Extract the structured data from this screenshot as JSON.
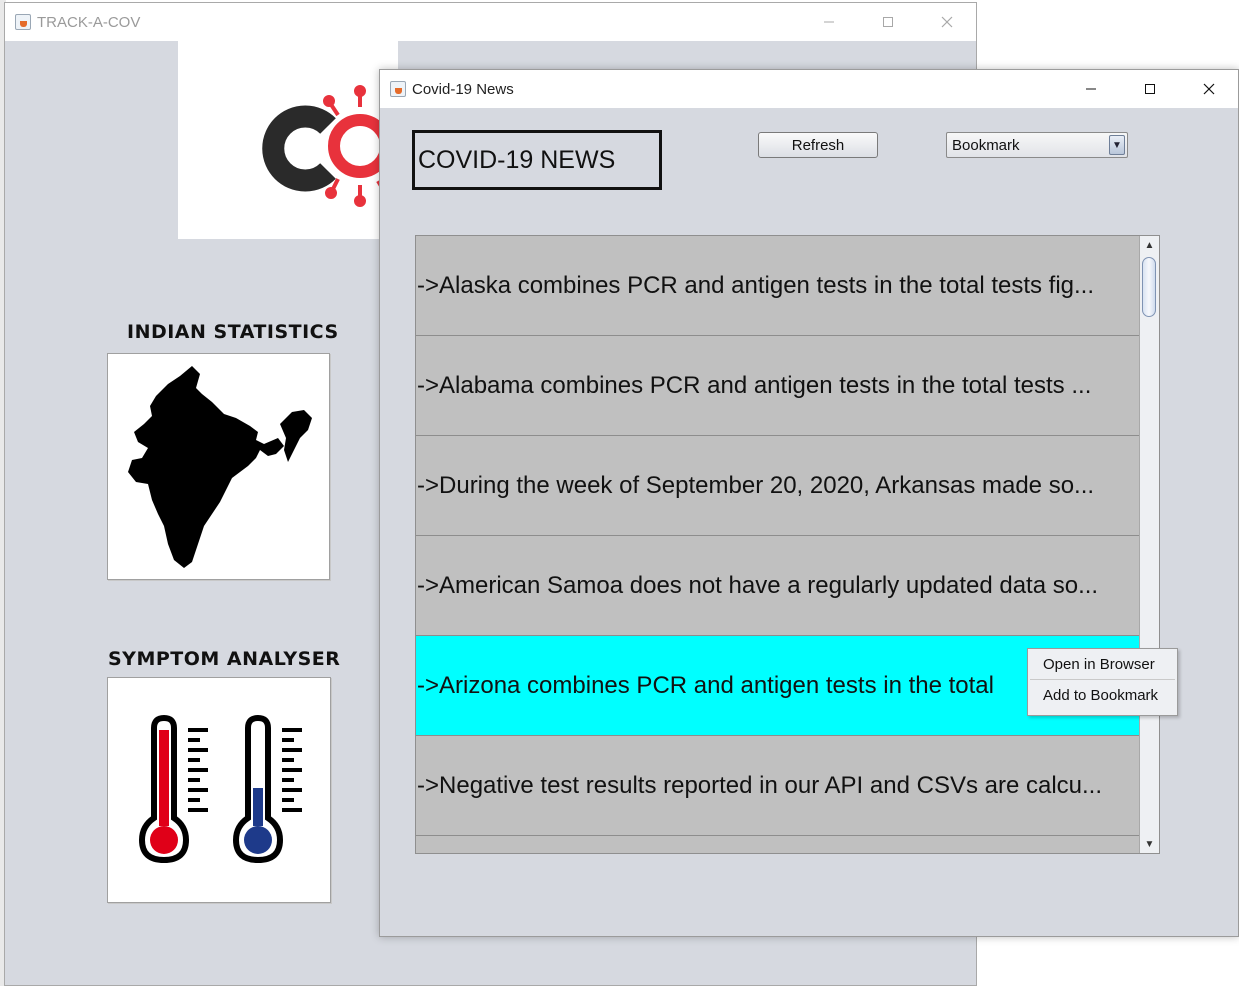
{
  "main_window": {
    "title": "TRACK-A-COV",
    "sections": {
      "indian_statistics": "INDIAN STATISTICS",
      "symptom_analyser": "SYMPTOM ANALYSER"
    }
  },
  "news_window": {
    "title": "Covid-19 News",
    "header": "COVID-19 NEWS",
    "refresh_label": "Refresh",
    "bookmark_select": "Bookmark",
    "items": [
      "->Alaska combines PCR and antigen tests in the total tests fig...",
      "->Alabama combines PCR and antigen tests in the total tests ...",
      "->During the week of September 20, 2020, Arkansas made so...",
      "->American Samoa does not have a regularly updated data so...",
      "->Arizona combines PCR and antigen tests in the total",
      "->Negative test results reported in our API and CSVs are calcu..."
    ],
    "selected_index": 4,
    "context_menu": [
      "Open in Browser",
      "Add to Bookmark"
    ]
  },
  "colors": {
    "window_bg": "#d6d9e0",
    "list_item_bg": "#c0c0c0",
    "selected_bg": "#00ffff",
    "virus_red": "#e8323c"
  },
  "icons": {
    "window_controls": [
      "minimize-icon",
      "maximize-icon",
      "close-icon"
    ]
  }
}
